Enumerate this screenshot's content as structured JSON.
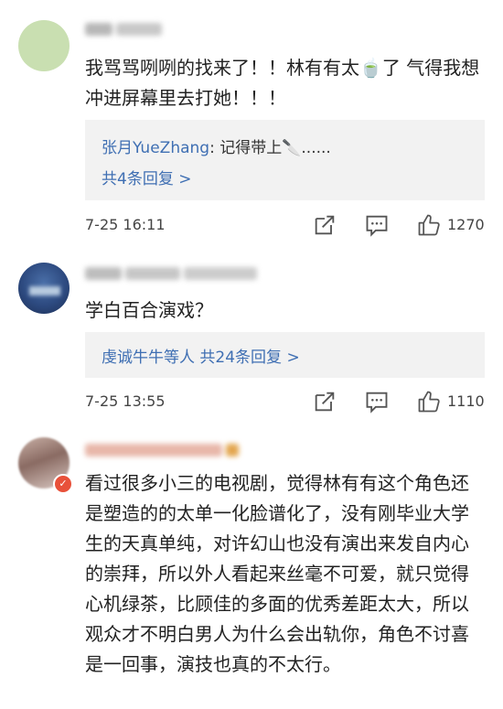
{
  "comments": [
    {
      "text": "我骂骂咧咧的找来了！！林有有太🍵了 气得我想冲进屏幕里去打她！！！",
      "reply_user": "张月YueZhang",
      "reply_sep": ":",
      "reply_text": "记得带上🔪......",
      "reply_count": "共4条回复 >",
      "time": "7-25 16:11",
      "likes": "1270"
    },
    {
      "text": "学白百合演戏？",
      "reply_line": "虔诚牛牛等人 共24条回复 >",
      "time": "7-25 13:55",
      "likes": "1110"
    },
    {
      "text": "看过很多小三的电视剧，觉得林有有这个角色还是塑造的的太单一化脸谱化了，没有刚毕业大学生的天真单纯，对许幻山也没有演出来发自内心的崇拜，所以外人看起来丝毫不可爱，就只觉得心机绿茶，比顾佳的多面的优秀差距太大，所以观众才不明白男人为什么会出轨你，角色不讨喜是一回事，演技也真的不太行。"
    }
  ],
  "icons": [
    "share-icon",
    "comment-icon",
    "like-icon"
  ]
}
